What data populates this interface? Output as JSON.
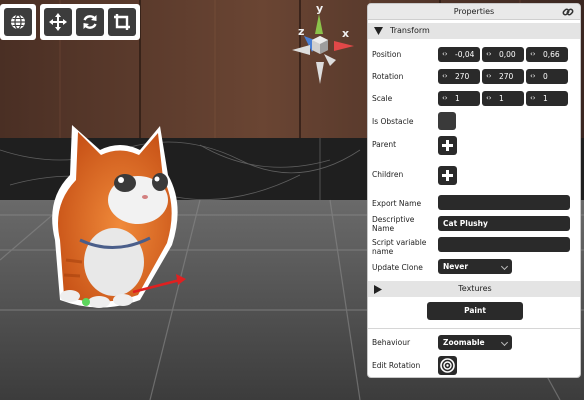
{
  "toolbar": {
    "buttons": [
      {
        "name": "globe-button",
        "icon": "globe-icon"
      },
      {
        "name": "move-button",
        "icon": "move-arrows-icon"
      },
      {
        "name": "rotate-button",
        "icon": "refresh-icon"
      },
      {
        "name": "crop-button",
        "icon": "crop-icon"
      }
    ]
  },
  "gizmo": {
    "x_label": "x",
    "y_label": "y",
    "z_label": "z"
  },
  "panel": {
    "title": "Properties",
    "transform_section": "Transform",
    "position": {
      "label": "Position",
      "x": "-0,04",
      "y": "0,00",
      "z": "0,66"
    },
    "rotation": {
      "label": "Rotation",
      "x": "270",
      "y": "270",
      "z": "0"
    },
    "scale": {
      "label": "Scale",
      "x": "1",
      "y": "1",
      "z": "1"
    },
    "is_obstacle": {
      "label": "Is Obstacle"
    },
    "parent": {
      "label": "Parent"
    },
    "children": {
      "label": "Children"
    },
    "export_name": {
      "label": "Export Name",
      "value": ""
    },
    "descriptive_name": {
      "label": "Descriptive Name",
      "value": "Cat Plushy"
    },
    "script_variable_name": {
      "label": "Script variable name",
      "value": ""
    },
    "update_clone": {
      "label": "Update Clone",
      "value": "Never"
    },
    "textures_section": "Textures",
    "paint_button": "Paint",
    "behaviour": {
      "label": "Behaviour",
      "value": "Zoomable"
    },
    "edit_rotation": {
      "label": "Edit Rotation"
    }
  },
  "colors": {
    "panel_bg": "#ffffff",
    "control_dark": "#2a2a2a",
    "axis_x": "#e04848",
    "axis_y": "#8bc34a",
    "axis_z": "#4a7fd4"
  }
}
